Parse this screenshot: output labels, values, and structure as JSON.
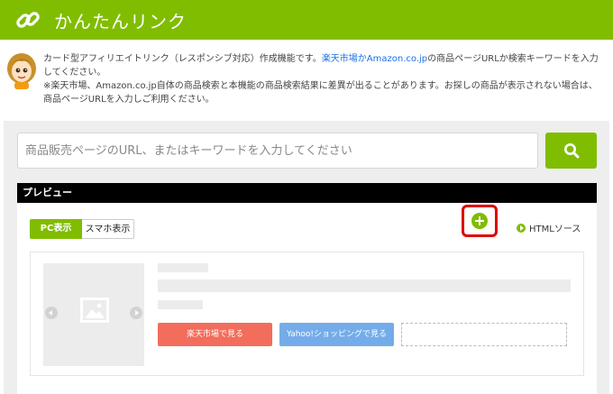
{
  "header": {
    "title": "かんたんリンク",
    "logo_icon": "link-chain-icon"
  },
  "description": {
    "mascot_icon": "girl-mascot-icon",
    "line1_pre": "カード型アフィリエイトリンク（レスポンシブ対応）作成機能です。",
    "line1_link": "楽天市場かAmazon.co.jp",
    "line1_post": "の商品ページURLか検索キーワードを入力してください。",
    "line2": "※楽天市場、Amazon.co.jp自体の商品検索と本機能の商品検索結果に差異が出ることがあります。お探しの商品が表示されない場合は、商品ページURLを入力しご利用ください。"
  },
  "search": {
    "placeholder": "商品販売ページのURL、またはキーワードを入力してください",
    "button_icon": "search-icon"
  },
  "preview": {
    "title": "プレビュー",
    "tabs": [
      {
        "label": "PC表示",
        "active": true
      },
      {
        "label": "スマホ表示",
        "active": false
      }
    ],
    "html_source_label": "HTMLソース",
    "card": {
      "image_icon": "image-placeholder-icon",
      "rakuten_button": "楽天市場で見る",
      "yahoo_button": "Yahoo!ショッピングで見る",
      "add_button_icon": "plus-circle-icon"
    }
  },
  "colors": {
    "brand_green": "#80bd01",
    "rakuten_red": "#f26d5b",
    "yahoo_blue": "#74acea",
    "highlight_red": "#e00000"
  }
}
